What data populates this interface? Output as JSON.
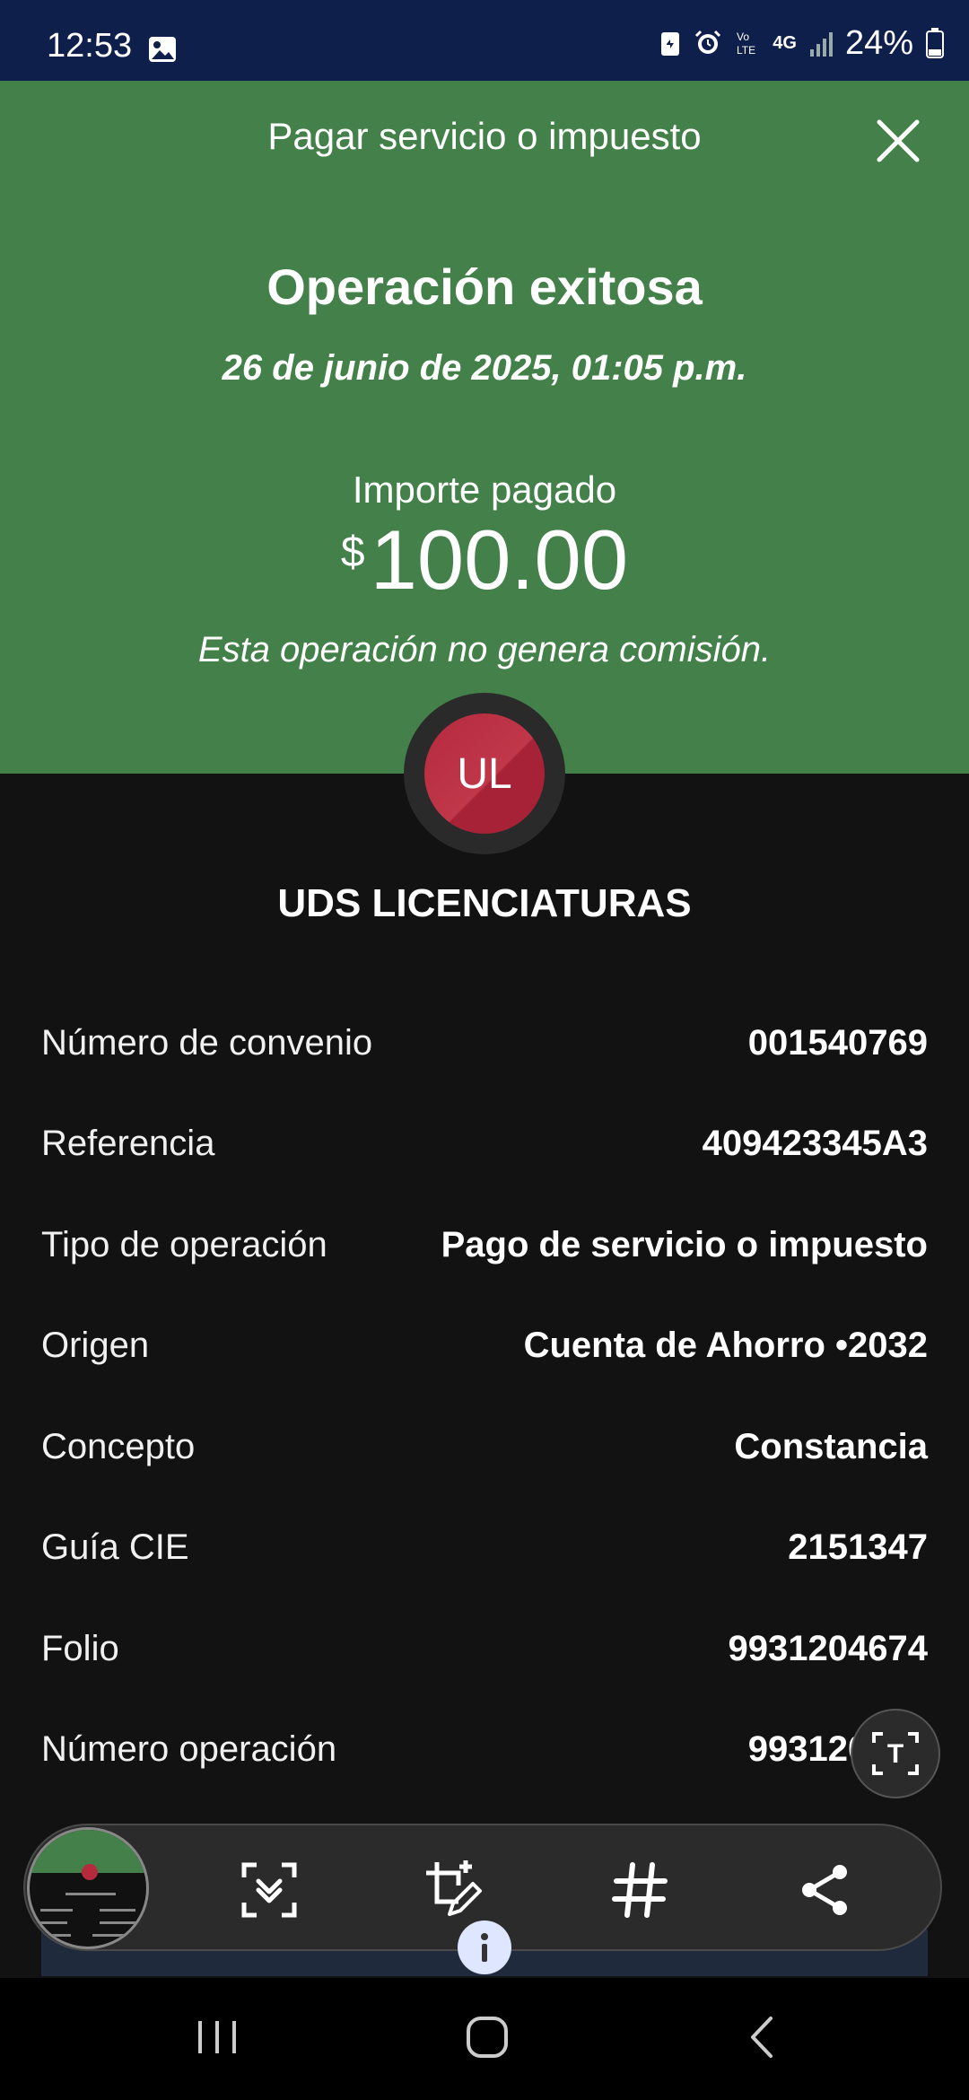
{
  "status_bar": {
    "time": "12:53",
    "network": "4G",
    "battery": "24%"
  },
  "header": {
    "title": "Pagar servicio o impuesto",
    "close_icon": "close-icon",
    "color": "#43804a"
  },
  "operation": {
    "title": "Operación exitosa",
    "date": "26 de junio de 2025, 01:05 p.m.",
    "amount_label": "Importe pagado",
    "currency": "$",
    "amount": "100.00",
    "commission_note": "Esta operación no genera comisión."
  },
  "merchant": {
    "initials": "UL",
    "name": "UDS LICENCIATURAS",
    "avatar_color": "#b62a3e"
  },
  "details": [
    {
      "label": "Número de convenio",
      "value": "001540769"
    },
    {
      "label": "Referencia",
      "value": "409423345A3"
    },
    {
      "label": "Tipo de operación",
      "value": "Pago de servicio o impuesto"
    },
    {
      "label": "Origen",
      "value": "Cuenta de Ahorro •2032"
    },
    {
      "label": "Concepto",
      "value": "Constancia"
    },
    {
      "label": "Guía CIE",
      "value": "2151347"
    },
    {
      "label": "Folio",
      "value": "9931204674"
    },
    {
      "label": "Número operación",
      "value": "993120474"
    }
  ],
  "screenshot_toolbar": {
    "icons": [
      "scroll-capture-icon",
      "crop-edit-icon",
      "hashtag-icon",
      "share-icon"
    ]
  },
  "floating": {
    "text_button_label": "T"
  },
  "nav": {
    "icons": [
      "recent-apps-icon",
      "home-icon",
      "back-icon"
    ]
  }
}
